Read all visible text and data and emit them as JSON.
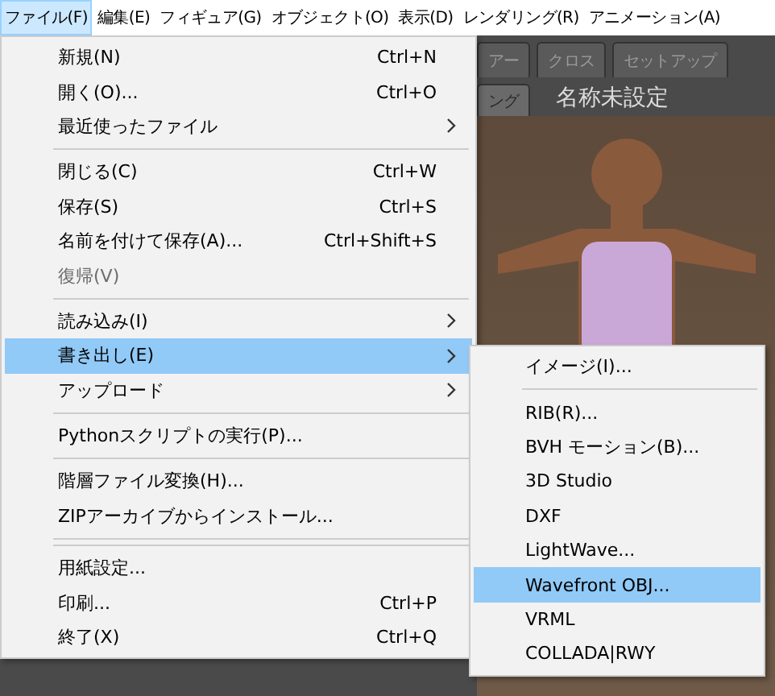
{
  "menubar": [
    {
      "label": "ファイル(F)",
      "selected": true
    },
    {
      "label": "編集(E)",
      "selected": false
    },
    {
      "label": "フィギュア(G)",
      "selected": false
    },
    {
      "label": "オブジェクト(O)",
      "selected": false
    },
    {
      "label": "表示(D)",
      "selected": false
    },
    {
      "label": "レンダリング(R)",
      "selected": false
    },
    {
      "label": "アニメーション(A)",
      "selected": false
    }
  ],
  "workspace": {
    "tabs": [
      {
        "label": "アー",
        "selected": false
      },
      {
        "label": "クロス",
        "selected": false
      },
      {
        "label": "セットアップ",
        "selected": false
      }
    ],
    "subtabs": [
      {
        "label": "ング",
        "selected": true
      }
    ],
    "document_title": "名称未設定"
  },
  "file_menu": {
    "items": [
      {
        "kind": "item",
        "label": "新規(N)",
        "shortcut": "Ctrl+N",
        "disabled": false,
        "submenu": false,
        "selected": false
      },
      {
        "kind": "item",
        "label": "開く(O)...",
        "shortcut": "Ctrl+O",
        "disabled": false,
        "submenu": false,
        "selected": false
      },
      {
        "kind": "item",
        "label": "最近使ったファイル",
        "disabled": false,
        "submenu": true,
        "selected": false
      },
      {
        "kind": "separator"
      },
      {
        "kind": "item",
        "label": "閉じる(C)",
        "shortcut": "Ctrl+W",
        "disabled": false,
        "submenu": false,
        "selected": false
      },
      {
        "kind": "item",
        "label": "保存(S)",
        "shortcut": "Ctrl+S",
        "disabled": false,
        "submenu": false,
        "selected": false
      },
      {
        "kind": "item",
        "label": "名前を付けて保存(A)...",
        "shortcut": "Ctrl+Shift+S",
        "disabled": false,
        "submenu": false,
        "selected": false
      },
      {
        "kind": "item",
        "label": "復帰(V)",
        "disabled": true,
        "submenu": false,
        "selected": false
      },
      {
        "kind": "separator"
      },
      {
        "kind": "item",
        "label": "読み込み(I)",
        "disabled": false,
        "submenu": true,
        "selected": false
      },
      {
        "kind": "item",
        "label": "書き出し(E)",
        "disabled": false,
        "submenu": true,
        "selected": true
      },
      {
        "kind": "item",
        "label": "アップロード",
        "disabled": false,
        "submenu": true,
        "selected": false
      },
      {
        "kind": "separator"
      },
      {
        "kind": "item",
        "label": "Pythonスクリプトの実行(P)...",
        "disabled": false,
        "submenu": false,
        "selected": false
      },
      {
        "kind": "separator"
      },
      {
        "kind": "item",
        "label": "階層ファイル変換(H)...",
        "disabled": false,
        "submenu": false,
        "selected": false
      },
      {
        "kind": "item",
        "label": "ZIPアーカイブからインストール...",
        "disabled": false,
        "submenu": false,
        "selected": false
      },
      {
        "kind": "separator"
      },
      {
        "kind": "separator"
      },
      {
        "kind": "item",
        "label": "用紙設定...",
        "disabled": false,
        "submenu": false,
        "selected": false
      },
      {
        "kind": "item",
        "label": "印刷...",
        "shortcut": "Ctrl+P",
        "disabled": false,
        "submenu": false,
        "selected": false
      },
      {
        "kind": "item",
        "label": "終了(X)",
        "shortcut": "Ctrl+Q",
        "disabled": false,
        "submenu": false,
        "selected": false
      }
    ]
  },
  "export_submenu": {
    "items": [
      {
        "kind": "item",
        "label": "イメージ(I)...",
        "selected": false
      },
      {
        "kind": "separator"
      },
      {
        "kind": "item",
        "label": "RIB(R)...",
        "selected": false
      },
      {
        "kind": "item",
        "label": "BVH モーション(B)...",
        "selected": false
      },
      {
        "kind": "item",
        "label": "3D Studio",
        "selected": false
      },
      {
        "kind": "item",
        "label": "DXF",
        "selected": false
      },
      {
        "kind": "item",
        "label": "LightWave...",
        "selected": false
      },
      {
        "kind": "item",
        "label": "Wavefront OBJ...",
        "selected": true
      },
      {
        "kind": "item",
        "label": "VRML",
        "selected": false
      },
      {
        "kind": "item",
        "label": "COLLADA|RWY",
        "selected": false
      }
    ]
  }
}
